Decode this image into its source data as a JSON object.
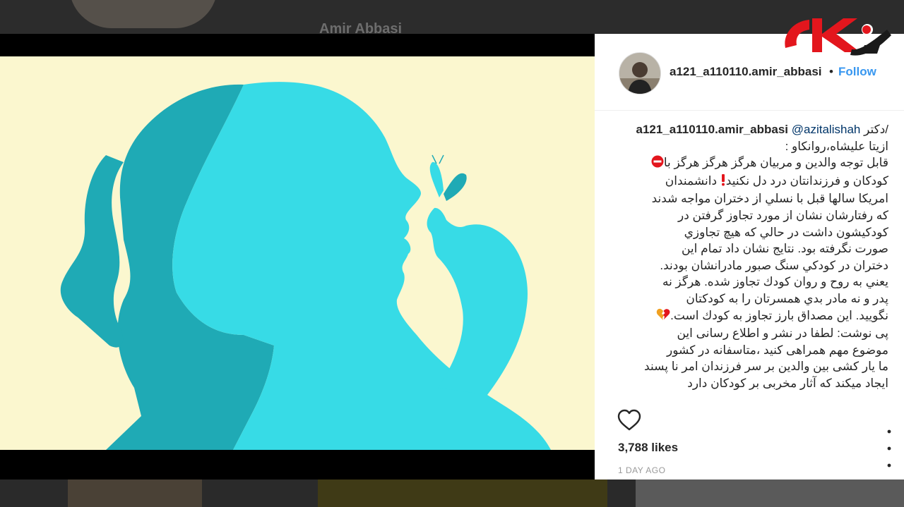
{
  "background": {
    "behind_name": "Amir Abbasi"
  },
  "post": {
    "username": "a121_a110110.amir_abbasi",
    "separator": "•",
    "follow_label": "Follow",
    "caption": {
      "username": "a121_a110110.amir_abbasi",
      "mention": "@azitalishah",
      "line0": "/دکتر",
      "line1": "ازیتا علیشاه،روانکاو :",
      "line2a": "قابل توجه والدین و مربیان هرگز هرگز هرگز با",
      "line3a": "کودکان و فرزندانتان درد دل نکنید",
      "line3b": " دانشمندان",
      "line4": "امریکا سالها قبل با نسلي از دختران مواجه شدند",
      "line5": "که رفتارشان نشان از مورد تجاوز گرفتن در",
      "line6": "کودکیشون داشت در حالي که هیچ تجاوزي",
      "line7": "صورت نگرفته بود. نتایج نشان داد تمام این",
      "line8": "دختران در کودکي سنگ صبور مادرانشان بودند.",
      "line9": "یعني به روح و روان کودك تجاوز شده. هرگز نه",
      "line10": "پدر و نه مادر بدي همسرتان را به کودکتان",
      "line11a": "نگویید. این مصداق بارز تجاوز به کودك است.",
      "line12": "پی نوشت: لطفا در نشر و اطلاع رسانی این",
      "line13": "موضوع مهم همراهی کنید ،متاسفانه در کشور",
      "line14": "ما یار کشی بین والدین بر سر فرزندان امر نا پسند",
      "line15": "ایجاد میکند که آثار مخربی بر کودکان دارد"
    },
    "likes": "3,788 likes",
    "time": "1 DAY AGO"
  },
  "icons": {
    "heart": "heart-outline-icon",
    "more": "more-vertical-icon",
    "no_entry": "no-entry-emoji",
    "exclamation": "red-exclamation-emoji",
    "broken_heart": "broken-heart-emoji"
  },
  "colors": {
    "follow": "#3897f0",
    "mention": "#003569",
    "illustration_bg": "#fbf7cf",
    "teal_dark": "#1faab5",
    "teal_light": "#37dbe6",
    "logo_red": "#e3161d"
  }
}
